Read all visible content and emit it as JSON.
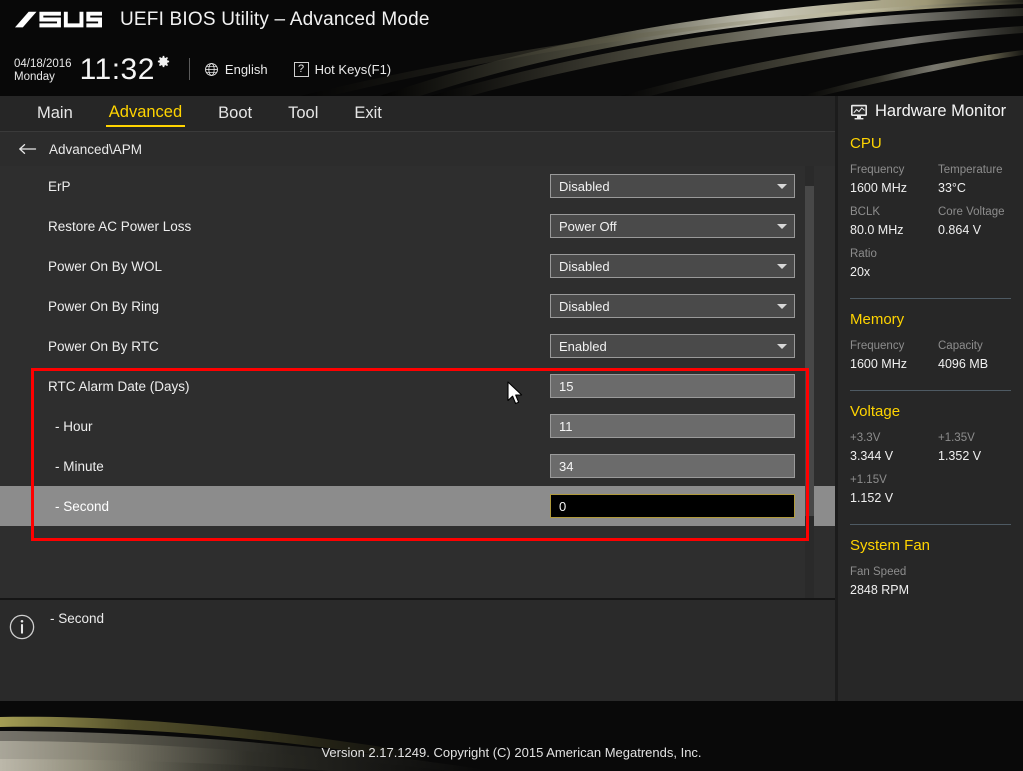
{
  "header": {
    "logo": "asus-logo",
    "title": "UEFI BIOS Utility – Advanced Mode",
    "date": "04/18/2016",
    "weekday": "Monday",
    "time": "11:32",
    "gear_icon": "gear-icon",
    "globe_icon": "globe-icon",
    "language": "English",
    "help_icon": "question-mark-icon",
    "hotkeys": "Hot Keys(F1)"
  },
  "tabs": [
    {
      "label": "Main",
      "active": false
    },
    {
      "label": "Advanced",
      "active": true
    },
    {
      "label": "Boot",
      "active": false
    },
    {
      "label": "Tool",
      "active": false
    },
    {
      "label": "Exit",
      "active": false
    }
  ],
  "breadcrumb": {
    "back_icon": "back-arrow-icon",
    "path": "Advanced\\APM"
  },
  "settings": [
    {
      "label": "ErP",
      "type": "select",
      "value": "Disabled",
      "selected": false
    },
    {
      "label": "Restore AC Power Loss",
      "type": "select",
      "value": "Power Off",
      "selected": false
    },
    {
      "label": "Power On By WOL",
      "type": "select",
      "value": "Disabled",
      "selected": false
    },
    {
      "label": "Power On By Ring",
      "type": "select",
      "value": "Disabled",
      "selected": false
    },
    {
      "label": "Power On By RTC",
      "type": "select",
      "value": "Enabled",
      "selected": false
    },
    {
      "label": "RTC Alarm Date (Days)",
      "type": "text",
      "value": "15",
      "selected": false
    },
    {
      "label": "- Hour",
      "type": "text",
      "value": "11",
      "selected": false
    },
    {
      "label": "- Minute",
      "type": "text",
      "value": "34",
      "selected": false
    },
    {
      "label": "- Second",
      "type": "text",
      "value": "0",
      "selected": true
    }
  ],
  "info": {
    "icon": "info-circle-icon",
    "text": "- Second"
  },
  "sidebar": {
    "icon": "hardware-monitor-icon",
    "title": "Hardware Monitor",
    "sections": [
      {
        "name": "CPU",
        "metrics": [
          {
            "label": "Frequency",
            "value": "1600 MHz"
          },
          {
            "label": "Temperature",
            "value": "33°C"
          },
          {
            "label": "BCLK",
            "value": "80.0 MHz"
          },
          {
            "label": "Core Voltage",
            "value": "0.864 V"
          },
          {
            "label": "Ratio",
            "value": "20x"
          }
        ]
      },
      {
        "name": "Memory",
        "metrics": [
          {
            "label": "Frequency",
            "value": "1600 MHz"
          },
          {
            "label": "Capacity",
            "value": "4096 MB"
          }
        ]
      },
      {
        "name": "Voltage",
        "metrics": [
          {
            "label": "+3.3V",
            "value": "3.344 V"
          },
          {
            "label": "+1.35V",
            "value": "1.352 V"
          },
          {
            "label": "+1.15V",
            "value": "1.152 V"
          }
        ]
      },
      {
        "name": "System Fan",
        "metrics": [
          {
            "label": "Fan Speed",
            "value": "2848 RPM"
          }
        ]
      }
    ]
  },
  "footer": {
    "version": "Version 2.17.1249. Copyright (C) 2015 American Megatrends, Inc."
  },
  "highlight": {
    "color": "#ff0000"
  },
  "colors": {
    "accent_yellow": "#ffd400",
    "panel_bg": "#2e2e2e",
    "selected_row": "#8c8c8c",
    "focused_field_bg": "#000000",
    "focused_field_border": "#b09a3c"
  },
  "cursor": {
    "icon": "mouse-pointer-icon"
  }
}
